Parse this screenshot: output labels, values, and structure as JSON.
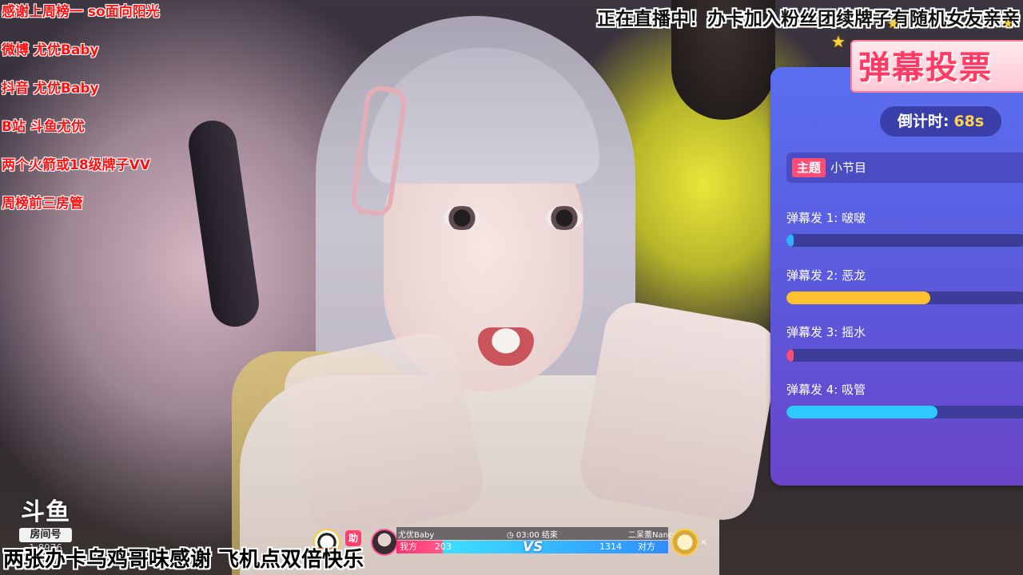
{
  "info_list": [
    "感谢上周榜一 so面向阳光",
    "微博 尤优Baby",
    "抖音 尤优Baby",
    "B站 斗鱼尤优",
    "两个火箭或18级牌子VV",
    "周榜前三房管"
  ],
  "banner": "正在直播中！办卡加入粉丝团续牌子有随机女友亲亲",
  "vote": {
    "title": "弹幕投票",
    "countdown_label": "倒计时:",
    "countdown_value": "68s",
    "topic_badge": "主题",
    "topic": "小节目",
    "options": [
      {
        "label": "弹幕发 1:  啵啵",
        "fraction": 0.03,
        "color": "#2fb0ff"
      },
      {
        "label": "弹幕发 2:  恶龙",
        "fraction": 0.6,
        "color": "#ffc12e"
      },
      {
        "label": "弹幕发 3:  摇水",
        "fraction": 0.02,
        "color": "#ff4c74"
      },
      {
        "label": "弹幕发 4:  吸管",
        "fraction": 0.63,
        "color": "#2ec7ff"
      }
    ]
  },
  "logo": {
    "mark": "斗鱼",
    "badge": "房间号",
    "room": "1 8976"
  },
  "pk": {
    "left_tag": "NO.1",
    "help": "助",
    "left_name": "尤优Baby",
    "timer": "◷ 03:00 结束",
    "right_name": "二呆蕾Nancy",
    "left_side": "我方",
    "left_score": "203",
    "vs": "VS",
    "right_score": "1314",
    "right_side": "对方",
    "left_fraction": 0.17,
    "close": "×"
  },
  "caption": "两张办卡乌鸡哥味感谢 飞机点双倍快乐",
  "colors": {
    "info_text": "#ff1010",
    "panel_top": "#5a6ff0",
    "panel_bottom": "#6a45c9",
    "accent_pink": "#ff4c74",
    "accent_yellow": "#ffd34d"
  }
}
